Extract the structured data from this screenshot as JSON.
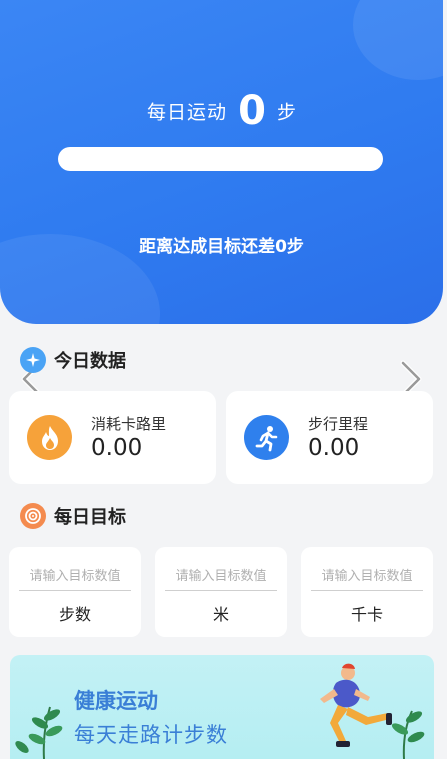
{
  "hero": {
    "daily_label": "每日运动",
    "daily_steps": "0",
    "daily_unit": "步",
    "progress_fraction": 0,
    "remaining_text": "距离达成目标还差0步"
  },
  "today": {
    "title": "今日数据",
    "calories": {
      "label": "消耗卡路里",
      "value": "0.00"
    },
    "distance": {
      "label": "步行里程",
      "value": "0.00"
    }
  },
  "goals": {
    "title": "每日目标",
    "placeholder": "请输入目标数值",
    "items": [
      {
        "unit": "步数"
      },
      {
        "unit": "米"
      },
      {
        "unit": "千卡"
      }
    ]
  },
  "banner": {
    "title": "健康运动",
    "subtitle": "每天走路计步数"
  },
  "colors": {
    "primary_blue": "#2f7bf0",
    "fire_orange": "#f6a23a",
    "runner_blue": "#2f80ed",
    "target_orange": "#f48b4f",
    "banner_bg": "#c3f1f5"
  }
}
